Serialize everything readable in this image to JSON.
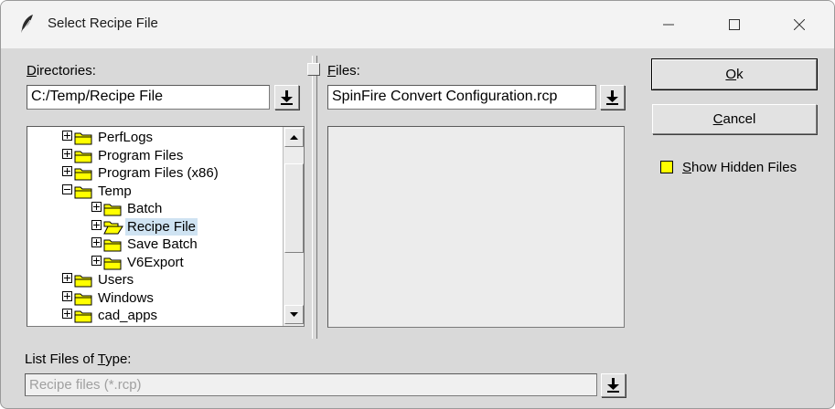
{
  "window": {
    "title": "Select Recipe File"
  },
  "directories": {
    "label_mnemonic": "D",
    "label_rest": "irectories:",
    "path": "C:/Temp/Recipe File",
    "tree": [
      {
        "label": "PerfLogs",
        "depth": 0,
        "expander": "plus",
        "folder": "closed",
        "selected": false
      },
      {
        "label": "Program Files",
        "depth": 0,
        "expander": "plus",
        "folder": "closed",
        "selected": false
      },
      {
        "label": "Program Files (x86)",
        "depth": 0,
        "expander": "plus",
        "folder": "closed",
        "selected": false
      },
      {
        "label": "Temp",
        "depth": 0,
        "expander": "minus",
        "folder": "closed",
        "selected": false
      },
      {
        "label": "Batch",
        "depth": 1,
        "expander": "plus",
        "folder": "closed",
        "selected": false
      },
      {
        "label": "Recipe File",
        "depth": 1,
        "expander": "plus",
        "folder": "open",
        "selected": true
      },
      {
        "label": "Save Batch",
        "depth": 1,
        "expander": "plus",
        "folder": "closed",
        "selected": false
      },
      {
        "label": "V6Export",
        "depth": 1,
        "expander": "plus",
        "folder": "closed",
        "selected": false
      },
      {
        "label": "Users",
        "depth": 0,
        "expander": "plus",
        "folder": "closed",
        "selected": false
      },
      {
        "label": "Windows",
        "depth": 0,
        "expander": "plus",
        "folder": "closed",
        "selected": false
      },
      {
        "label": "cad_apps",
        "depth": 0,
        "expander": "plus",
        "folder": "closed",
        "selected": false
      }
    ]
  },
  "files": {
    "label_mnemonic": "F",
    "label_rest": "iles:",
    "selected": "SpinFire Convert Configuration.rcp",
    "items": []
  },
  "filetype": {
    "label_before": "List Files of ",
    "label_mnemonic": "T",
    "label_after": "ype:",
    "value": "Recipe files (*.rcp)"
  },
  "buttons": {
    "ok_mnemonic": "O",
    "ok_rest": "k",
    "cancel_mnemonic": "C",
    "cancel_rest": "ancel"
  },
  "hidden_files": {
    "label_mnemonic": "S",
    "label_rest": "how Hidden Files",
    "checked": true
  },
  "colors": {
    "dialog_bg": "#d9d9d9",
    "selection": "#cfe3f2",
    "folder": "#ffff00",
    "checkbox": "#ffff00"
  },
  "icons": {
    "app": "feather-icon",
    "dropdown": "arrow-down-bar-icon",
    "expand": "plus-box-icon",
    "collapse": "minus-box-icon",
    "folder_closed": "folder-icon",
    "folder_open": "folder-open-icon"
  }
}
